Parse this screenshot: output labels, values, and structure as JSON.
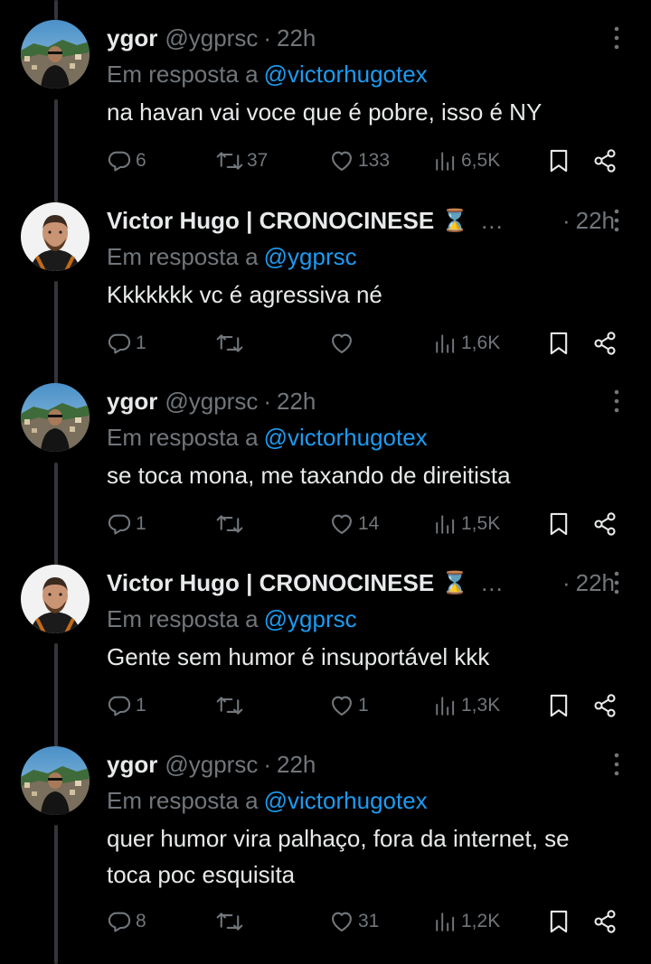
{
  "reply_prefix": "Em resposta a",
  "colors": {
    "background": "#000000",
    "text": "#e7e9ea",
    "muted": "#71767b",
    "link": "#1d9bf0",
    "thread": "#333639"
  },
  "icons": {
    "reply": "reply-icon",
    "retweet": "retweet-icon",
    "like": "heart-icon",
    "views": "views-icon",
    "bookmark": "bookmark-icon",
    "share": "share-icon",
    "more": "more-vertical-icon",
    "verified_badge": "hourglass-emoji"
  },
  "tweets": [
    {
      "name": "ygor",
      "handle": "@ygprsc",
      "sep": "·",
      "time": "22h",
      "reply_to": "@victorhugotex",
      "text": "na havan vai voce que é pobre, isso é NY",
      "replies": "6",
      "retweets": "37",
      "likes": "133",
      "views": "6,5K"
    },
    {
      "name": "Victor Hugo | CRONOCINESE",
      "badge": "⌛",
      "ellipsis": "...",
      "sep": "·",
      "time": "22h",
      "reply_to": "@ygprsc",
      "text": "Kkkkkkk vc é agressiva né",
      "replies": "1",
      "retweets": "",
      "likes": "",
      "views": "1,6K"
    },
    {
      "name": "ygor",
      "handle": "@ygprsc",
      "sep": "·",
      "time": "22h",
      "reply_to": "@victorhugotex",
      "text": "se toca mona, me taxando de direitista",
      "replies": "1",
      "retweets": "",
      "likes": "14",
      "views": "1,5K"
    },
    {
      "name": "Victor Hugo | CRONOCINESE",
      "badge": "⌛",
      "ellipsis": "...",
      "sep": "·",
      "time": "22h",
      "reply_to": "@ygprsc",
      "text": "Gente sem humor é insuportável kkk",
      "replies": "1",
      "retweets": "",
      "likes": "1",
      "views": "1,3K"
    },
    {
      "name": "ygor",
      "handle": "@ygprsc",
      "sep": "·",
      "time": "22h",
      "reply_to": "@victorhugotex",
      "text": "quer humor vira palhaço, fora da internet, se toca poc esquisita",
      "replies": "8",
      "retweets": "",
      "likes": "31",
      "views": "1,2K"
    }
  ]
}
